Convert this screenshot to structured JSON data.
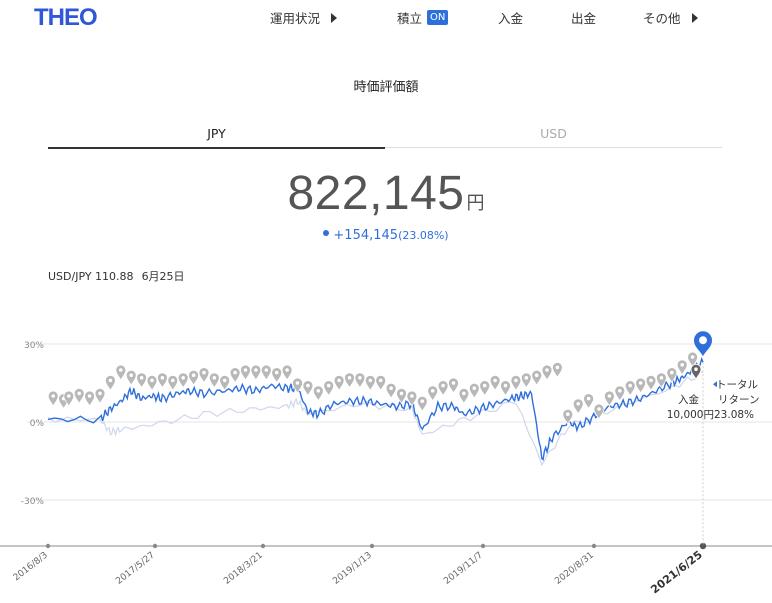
{
  "header": {
    "logo": "THEO",
    "nav": [
      {
        "label": "運用状況",
        "arrow": true
      },
      {
        "label": "積立",
        "badge": "ON"
      },
      {
        "label": "入金"
      },
      {
        "label": "出金"
      },
      {
        "label": "その他",
        "arrow": true
      }
    ]
  },
  "main": {
    "title": "時価評価額",
    "tabs": [
      {
        "label": "JPY",
        "active": true
      },
      {
        "label": "USD",
        "active": false
      }
    ],
    "valuation": {
      "amount": "822,145",
      "unit": "円"
    },
    "change": {
      "value": "+154,145",
      "percent": "(23.08%)"
    },
    "fx": {
      "label": "USD/JPY 110.88",
      "date": "6月25日"
    }
  },
  "colors": {
    "accent": "#2f6fdb",
    "brand": "#2f58d8",
    "comparison": "#d0d6ee",
    "marker": "#b8b8b8"
  },
  "chart_data": {
    "type": "line",
    "y_ticks": [
      "30%",
      "0%",
      "-30%"
    ],
    "ylim": [
      -45,
      33
    ],
    "x_ticks": [
      "2016/8/3",
      "2017/5/27",
      "2018/3/21",
      "2019/1/13",
      "2019/11/7",
      "2020/8/31",
      "2021/6/25"
    ],
    "x_tick_highlight": "2021/6/25",
    "series": [
      {
        "points": [
          [
            0,
            1
          ],
          [
            10,
            1
          ],
          [
            12,
            5
          ],
          [
            14,
            8
          ],
          [
            16,
            12
          ],
          [
            18,
            9
          ],
          [
            20,
            10
          ],
          [
            22,
            9
          ],
          [
            25,
            11
          ],
          [
            27,
            12
          ],
          [
            30,
            11
          ],
          [
            34,
            12
          ],
          [
            37,
            13
          ],
          [
            40,
            12
          ],
          [
            43,
            14
          ],
          [
            46,
            13
          ],
          [
            48,
            13
          ],
          [
            50,
            4
          ],
          [
            52,
            3
          ],
          [
            55,
            7
          ],
          [
            58,
            8
          ],
          [
            61,
            8
          ],
          [
            64,
            7
          ],
          [
            67,
            6
          ],
          [
            70,
            7
          ],
          [
            72,
            -3
          ],
          [
            75,
            6
          ],
          [
            78,
            6
          ],
          [
            80,
            3
          ],
          [
            83,
            5
          ],
          [
            86,
            7
          ],
          [
            89,
            9
          ],
          [
            91,
            10
          ],
          [
            93,
            11
          ],
          [
            95,
            -14
          ],
          [
            97,
            -6
          ],
          [
            100,
            0
          ],
          [
            102,
            -2
          ],
          [
            105,
            2
          ],
          [
            108,
            6
          ],
          [
            111,
            7
          ],
          [
            114,
            9
          ],
          [
            117,
            12
          ],
          [
            120,
            15
          ],
          [
            122,
            17
          ],
          [
            124,
            20
          ],
          [
            126,
            23
          ]
        ]
      },
      {
        "points": [
          [
            0,
            1
          ],
          [
            10,
            1
          ],
          [
            12,
            -4
          ],
          [
            14,
            -3
          ],
          [
            20,
            -1
          ],
          [
            30,
            3
          ],
          [
            40,
            5
          ],
          [
            46,
            6
          ],
          [
            48,
            8
          ],
          [
            50,
            3
          ],
          [
            60,
            7
          ],
          [
            70,
            5
          ],
          [
            72,
            -5
          ],
          [
            80,
            1
          ],
          [
            90,
            8
          ],
          [
            95,
            -16
          ],
          [
            100,
            -2
          ],
          [
            110,
            6
          ],
          [
            120,
            13
          ],
          [
            126,
            19
          ]
        ]
      }
    ],
    "deposit_markers": [
      [
        1,
        5
      ],
      [
        3,
        4
      ],
      [
        4,
        5
      ],
      [
        6,
        6
      ],
      [
        8,
        5
      ],
      [
        10,
        6
      ],
      [
        12,
        11
      ],
      [
        14,
        15
      ],
      [
        16,
        13
      ],
      [
        18,
        12
      ],
      [
        20,
        11
      ],
      [
        22,
        12
      ],
      [
        24,
        11
      ],
      [
        26,
        12
      ],
      [
        28,
        13
      ],
      [
        30,
        14
      ],
      [
        32,
        12
      ],
      [
        34,
        11
      ],
      [
        36,
        14
      ],
      [
        38,
        15
      ],
      [
        40,
        15
      ],
      [
        42,
        15
      ],
      [
        44,
        14
      ],
      [
        46,
        15
      ],
      [
        48,
        10
      ],
      [
        50,
        9
      ],
      [
        52,
        7
      ],
      [
        54,
        9
      ],
      [
        56,
        11
      ],
      [
        58,
        12
      ],
      [
        60,
        12
      ],
      [
        62,
        11
      ],
      [
        64,
        11
      ],
      [
        66,
        8
      ],
      [
        68,
        6
      ],
      [
        70,
        5
      ],
      [
        72,
        3
      ],
      [
        74,
        7
      ],
      [
        76,
        9
      ],
      [
        78,
        10
      ],
      [
        80,
        6
      ],
      [
        82,
        8
      ],
      [
        84,
        9
      ],
      [
        86,
        11
      ],
      [
        88,
        9
      ],
      [
        90,
        11
      ],
      [
        92,
        12
      ],
      [
        94,
        13
      ],
      [
        96,
        15
      ],
      [
        98,
        16
      ],
      [
        100,
        -2
      ],
      [
        102,
        2
      ],
      [
        104,
        4
      ],
      [
        106,
        0
      ],
      [
        108,
        5
      ],
      [
        110,
        7
      ],
      [
        112,
        9
      ],
      [
        114,
        10
      ],
      [
        116,
        11
      ],
      [
        118,
        12
      ],
      [
        120,
        14
      ],
      [
        122,
        17
      ],
      [
        124,
        20
      ],
      [
        126,
        24
      ]
    ],
    "endpoint_callout": {
      "deposit_label": "入金",
      "deposit_amount": "10,000円",
      "return_label_1": "トータル",
      "return_label_2": "リターン",
      "return_value": "23.08%"
    }
  }
}
